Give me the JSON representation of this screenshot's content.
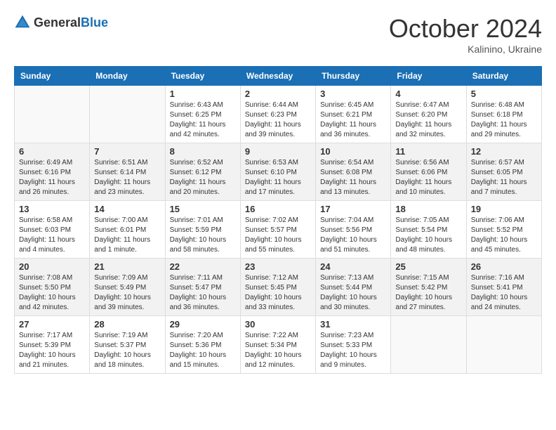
{
  "header": {
    "logo_general": "General",
    "logo_blue": "Blue",
    "month": "October 2024",
    "location": "Kalinino, Ukraine"
  },
  "days_of_week": [
    "Sunday",
    "Monday",
    "Tuesday",
    "Wednesday",
    "Thursday",
    "Friday",
    "Saturday"
  ],
  "weeks": [
    [
      {
        "day": "",
        "info": ""
      },
      {
        "day": "",
        "info": ""
      },
      {
        "day": "1",
        "info": "Sunrise: 6:43 AM\nSunset: 6:25 PM\nDaylight: 11 hours and 42 minutes."
      },
      {
        "day": "2",
        "info": "Sunrise: 6:44 AM\nSunset: 6:23 PM\nDaylight: 11 hours and 39 minutes."
      },
      {
        "day": "3",
        "info": "Sunrise: 6:45 AM\nSunset: 6:21 PM\nDaylight: 11 hours and 36 minutes."
      },
      {
        "day": "4",
        "info": "Sunrise: 6:47 AM\nSunset: 6:20 PM\nDaylight: 11 hours and 32 minutes."
      },
      {
        "day": "5",
        "info": "Sunrise: 6:48 AM\nSunset: 6:18 PM\nDaylight: 11 hours and 29 minutes."
      }
    ],
    [
      {
        "day": "6",
        "info": "Sunrise: 6:49 AM\nSunset: 6:16 PM\nDaylight: 11 hours and 26 minutes."
      },
      {
        "day": "7",
        "info": "Sunrise: 6:51 AM\nSunset: 6:14 PM\nDaylight: 11 hours and 23 minutes."
      },
      {
        "day": "8",
        "info": "Sunrise: 6:52 AM\nSunset: 6:12 PM\nDaylight: 11 hours and 20 minutes."
      },
      {
        "day": "9",
        "info": "Sunrise: 6:53 AM\nSunset: 6:10 PM\nDaylight: 11 hours and 17 minutes."
      },
      {
        "day": "10",
        "info": "Sunrise: 6:54 AM\nSunset: 6:08 PM\nDaylight: 11 hours and 13 minutes."
      },
      {
        "day": "11",
        "info": "Sunrise: 6:56 AM\nSunset: 6:06 PM\nDaylight: 11 hours and 10 minutes."
      },
      {
        "day": "12",
        "info": "Sunrise: 6:57 AM\nSunset: 6:05 PM\nDaylight: 11 hours and 7 minutes."
      }
    ],
    [
      {
        "day": "13",
        "info": "Sunrise: 6:58 AM\nSunset: 6:03 PM\nDaylight: 11 hours and 4 minutes."
      },
      {
        "day": "14",
        "info": "Sunrise: 7:00 AM\nSunset: 6:01 PM\nDaylight: 11 hours and 1 minute."
      },
      {
        "day": "15",
        "info": "Sunrise: 7:01 AM\nSunset: 5:59 PM\nDaylight: 10 hours and 58 minutes."
      },
      {
        "day": "16",
        "info": "Sunrise: 7:02 AM\nSunset: 5:57 PM\nDaylight: 10 hours and 55 minutes."
      },
      {
        "day": "17",
        "info": "Sunrise: 7:04 AM\nSunset: 5:56 PM\nDaylight: 10 hours and 51 minutes."
      },
      {
        "day": "18",
        "info": "Sunrise: 7:05 AM\nSunset: 5:54 PM\nDaylight: 10 hours and 48 minutes."
      },
      {
        "day": "19",
        "info": "Sunrise: 7:06 AM\nSunset: 5:52 PM\nDaylight: 10 hours and 45 minutes."
      }
    ],
    [
      {
        "day": "20",
        "info": "Sunrise: 7:08 AM\nSunset: 5:50 PM\nDaylight: 10 hours and 42 minutes."
      },
      {
        "day": "21",
        "info": "Sunrise: 7:09 AM\nSunset: 5:49 PM\nDaylight: 10 hours and 39 minutes."
      },
      {
        "day": "22",
        "info": "Sunrise: 7:11 AM\nSunset: 5:47 PM\nDaylight: 10 hours and 36 minutes."
      },
      {
        "day": "23",
        "info": "Sunrise: 7:12 AM\nSunset: 5:45 PM\nDaylight: 10 hours and 33 minutes."
      },
      {
        "day": "24",
        "info": "Sunrise: 7:13 AM\nSunset: 5:44 PM\nDaylight: 10 hours and 30 minutes."
      },
      {
        "day": "25",
        "info": "Sunrise: 7:15 AM\nSunset: 5:42 PM\nDaylight: 10 hours and 27 minutes."
      },
      {
        "day": "26",
        "info": "Sunrise: 7:16 AM\nSunset: 5:41 PM\nDaylight: 10 hours and 24 minutes."
      }
    ],
    [
      {
        "day": "27",
        "info": "Sunrise: 7:17 AM\nSunset: 5:39 PM\nDaylight: 10 hours and 21 minutes."
      },
      {
        "day": "28",
        "info": "Sunrise: 7:19 AM\nSunset: 5:37 PM\nDaylight: 10 hours and 18 minutes."
      },
      {
        "day": "29",
        "info": "Sunrise: 7:20 AM\nSunset: 5:36 PM\nDaylight: 10 hours and 15 minutes."
      },
      {
        "day": "30",
        "info": "Sunrise: 7:22 AM\nSunset: 5:34 PM\nDaylight: 10 hours and 12 minutes."
      },
      {
        "day": "31",
        "info": "Sunrise: 7:23 AM\nSunset: 5:33 PM\nDaylight: 10 hours and 9 minutes."
      },
      {
        "day": "",
        "info": ""
      },
      {
        "day": "",
        "info": ""
      }
    ]
  ]
}
